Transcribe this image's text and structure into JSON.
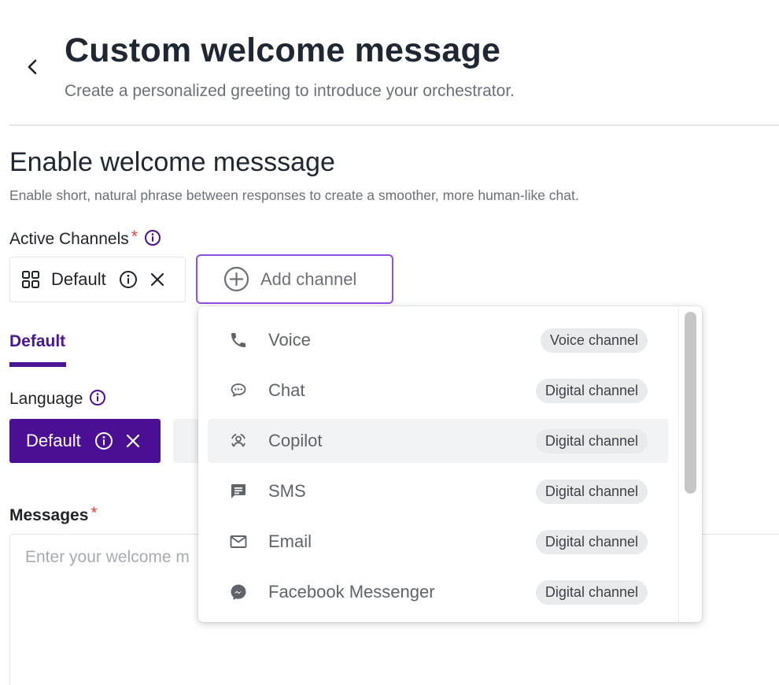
{
  "header": {
    "title": "Custom welcome message",
    "subtitle": "Create a personalized greeting to introduce your orchestrator."
  },
  "section": {
    "title": "Enable welcome messsage",
    "description": "Enable short, natural phrase between responses to create a smoother, more human-like chat."
  },
  "active_channels": {
    "label": "Active Channels",
    "required_mark": "*",
    "chips": [
      {
        "label": "Default"
      }
    ],
    "add_button_label": "Add channel"
  },
  "tabs": [
    {
      "label": "Default",
      "active": true
    }
  ],
  "language": {
    "label": "Language",
    "chips": [
      {
        "label": "Default"
      }
    ]
  },
  "messages": {
    "label": "Messages",
    "required_mark": "*",
    "placeholder": "Enter your welcome m"
  },
  "channel_dropdown": {
    "items": [
      {
        "label": "Voice",
        "badge": "Voice channel",
        "icon": "phone-icon"
      },
      {
        "label": "Chat",
        "badge": "Digital channel",
        "icon": "chat-bubble-icon"
      },
      {
        "label": "Copilot",
        "badge": "Digital channel",
        "icon": "copilot-icon",
        "highlighted": true
      },
      {
        "label": "SMS",
        "badge": "Digital channel",
        "icon": "sms-icon"
      },
      {
        "label": "Email",
        "badge": "Digital channel",
        "icon": "mail-icon"
      },
      {
        "label": "Facebook Messenger",
        "badge": "Digital channel",
        "icon": "messenger-icon"
      }
    ]
  },
  "colors": {
    "accent": "#4b0f95",
    "focus_border": "#8f4fe0",
    "required": "#e5423b"
  }
}
